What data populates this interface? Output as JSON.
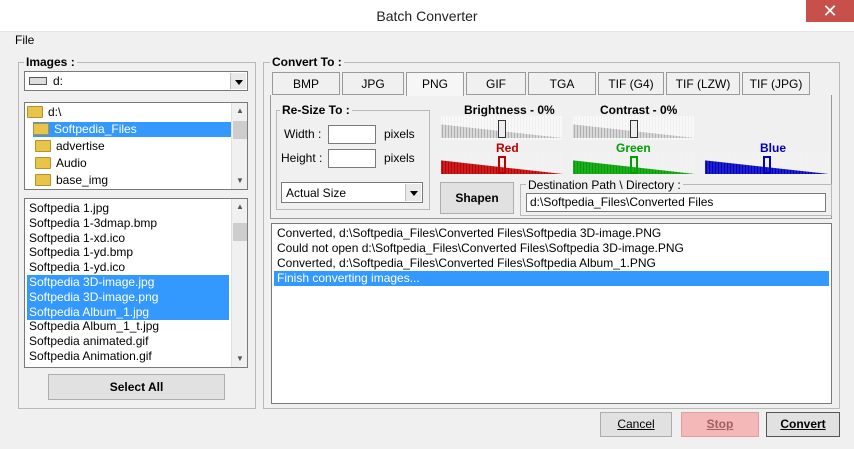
{
  "window": {
    "title": "Batch Converter",
    "close_glyph": "✕"
  },
  "menu": {
    "file": "File"
  },
  "images_group": {
    "label": "Images :",
    "drive_value": "d:",
    "folders": [
      {
        "label": "d:\\",
        "selected": false
      },
      {
        "label": "Softpedia_Files",
        "selected": true
      },
      {
        "label": "advertise",
        "selected": false
      },
      {
        "label": "Audio",
        "selected": false
      },
      {
        "label": "base_img",
        "selected": false
      }
    ],
    "files": [
      {
        "label": "Softpedia 1.jpg",
        "selected": false
      },
      {
        "label": "Softpedia 1-3dmap.bmp",
        "selected": false
      },
      {
        "label": "Softpedia 1-xd.ico",
        "selected": false
      },
      {
        "label": "Softpedia 1-yd.bmp",
        "selected": false
      },
      {
        "label": "Softpedia 1-yd.ico",
        "selected": false
      },
      {
        "label": "Softpedia 3D-image.jpg",
        "selected": true
      },
      {
        "label": "Softpedia 3D-image.png",
        "selected": true
      },
      {
        "label": "Softpedia Album_1.jpg",
        "selected": true
      },
      {
        "label": "Softpedia Album_1_t.jpg",
        "selected": false
      },
      {
        "label": "Softpedia animated.gif",
        "selected": false
      },
      {
        "label": "Softpedia Animation.gif",
        "selected": false
      }
    ],
    "select_all": "Select All"
  },
  "convert_group": {
    "label": "Convert To :",
    "tabs": [
      "BMP",
      "JPG",
      "PNG",
      "GIF",
      "TGA",
      "TIF (G4)",
      "TIF (LZW)",
      "TIF (JPG)"
    ],
    "active_tab": "PNG",
    "resize": {
      "label": "Re-Size To :",
      "width_label": "Width :",
      "height_label": "Height :",
      "width_value": "",
      "height_value": "",
      "units": "pixels",
      "size_option": "Actual Size"
    },
    "brightness": {
      "label": "Brightness - 0%",
      "level": 0.5
    },
    "contrast": {
      "label": "Contrast - 0%",
      "level": 0.5
    },
    "red": {
      "label": "Red",
      "level": 0.5,
      "color": "#c00000"
    },
    "green": {
      "label": "Green",
      "level": 0.5,
      "color": "#00a000"
    },
    "blue": {
      "label": "Blue",
      "level": 0.5,
      "color": "#0000c0"
    },
    "sharpen": "Shapen",
    "destination": {
      "label": "Destination Path \\ Directory :",
      "value": "d:\\Softpedia_Files\\Converted Files"
    },
    "log": [
      {
        "text": "Converted, d:\\Softpedia_Files\\Converted Files\\Softpedia 3D-image.PNG",
        "selected": false
      },
      {
        "text": "Could not open d:\\Softpedia_Files\\Converted Files\\Softpedia 3D-image.PNG",
        "selected": false
      },
      {
        "text": "Converted, d:\\Softpedia_Files\\Converted Files\\Softpedia Album_1.PNG",
        "selected": false
      },
      {
        "text": "Finish converting images...",
        "selected": true
      }
    ]
  },
  "buttons": {
    "cancel": "Cancel",
    "stop": "Stop",
    "convert": "Convert"
  },
  "colors": {
    "selection": "#3399ff",
    "stop_bg": "#f4b8b8"
  }
}
